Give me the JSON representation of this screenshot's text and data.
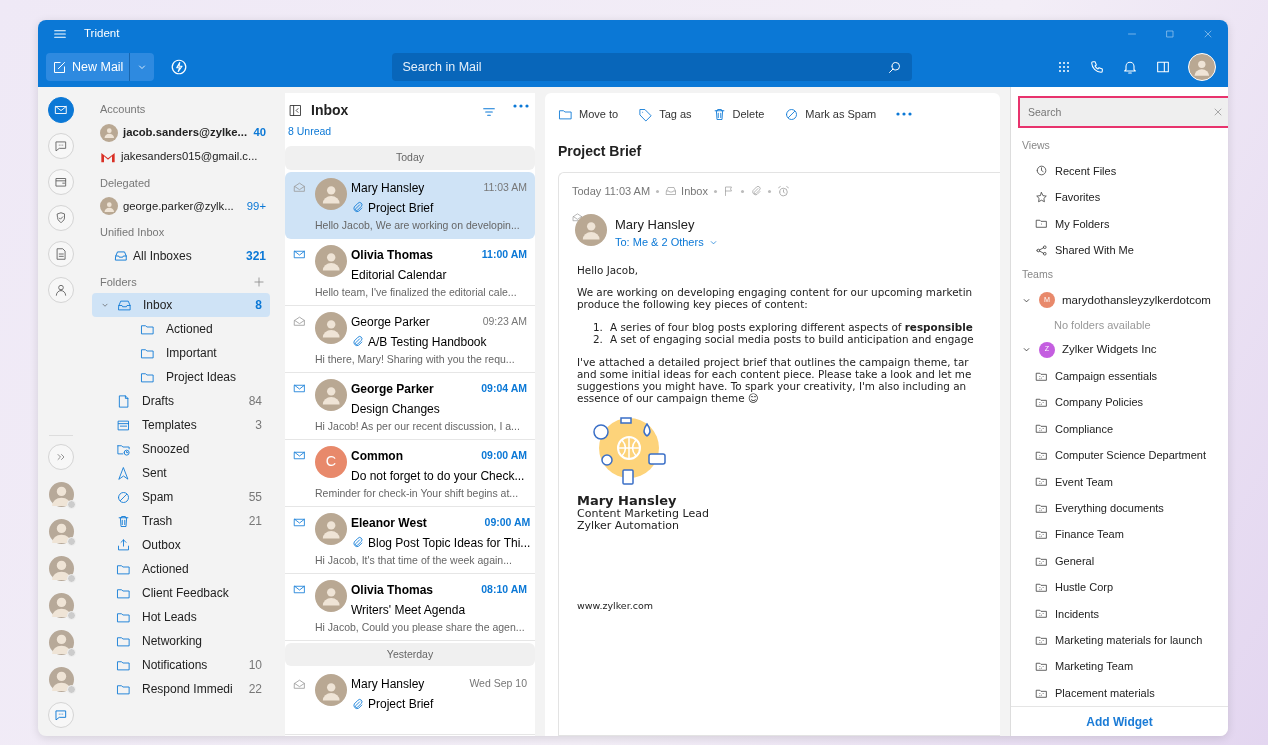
{
  "window": {
    "title": "Trident"
  },
  "toolbar": {
    "new_mail": "New Mail",
    "search": {
      "placeholder": "Search in Mail"
    }
  },
  "rail": {
    "apps": [
      {
        "selected": true
      },
      {
        "selected": false
      },
      {
        "selected": false
      },
      {
        "selected": false
      },
      {
        "selected": false
      },
      {
        "selected": false
      }
    ]
  },
  "accounts": {
    "title": "Accounts",
    "items": [
      {
        "kind": "photo",
        "label": "jacob.sanders@zylke...",
        "count": "40",
        "unread": true
      },
      {
        "kind": "gmail",
        "label": "jakesanders015@gmail.c...",
        "unread": false
      }
    ]
  },
  "delegated": {
    "title": "Delegated",
    "items": [
      {
        "kind": "photo",
        "label": "george.parker@zylk...",
        "count": "99+",
        "unread": false
      }
    ]
  },
  "unified": {
    "title": "Unified Inbox",
    "items": [
      {
        "kind": "inbox",
        "label": "All Inboxes",
        "count": "321",
        "unread": true
      }
    ]
  },
  "folders": {
    "title": "Folders",
    "items": [
      {
        "kind": "inbox",
        "label": "Inbox",
        "count": "8",
        "unread": true,
        "selected": true,
        "expanded": true,
        "children": [
          {
            "kind": "folder",
            "label": "Actioned",
            "selected": false
          },
          {
            "kind": "folder",
            "label": "Important",
            "selected": false
          },
          {
            "kind": "folder",
            "label": "Project Ideas",
            "selected": false
          }
        ]
      },
      {
        "kind": "drafts",
        "label": "Drafts",
        "count": "84",
        "unread": false,
        "selected": false
      },
      {
        "kind": "templates",
        "label": "Templates",
        "count": "3",
        "unread": false,
        "selected": false
      },
      {
        "kind": "snoozed",
        "label": "Snoozed",
        "selected": false
      },
      {
        "kind": "sent",
        "label": "Sent",
        "selected": false
      },
      {
        "kind": "spam",
        "label": "Spam",
        "count": "55",
        "unread": false,
        "selected": false
      },
      {
        "kind": "trash",
        "label": "Trash",
        "count": "21",
        "unread": false,
        "selected": false
      },
      {
        "kind": "outbox",
        "label": "Outbox",
        "selected": false
      },
      {
        "kind": "folder",
        "label": "Actioned",
        "selected": false
      },
      {
        "kind": "folder",
        "label": "Client Feedback",
        "selected": false
      },
      {
        "kind": "folder",
        "label": "Hot Leads",
        "selected": false
      },
      {
        "kind": "folder",
        "label": "Networking",
        "selected": false
      },
      {
        "kind": "folder",
        "label": "Notifications",
        "count": "10",
        "unread": false,
        "selected": false
      },
      {
        "kind": "folder",
        "label": "Respond Immedi",
        "count": "22",
        "unread": false,
        "selected": false
      }
    ]
  },
  "list": {
    "title": "Inbox",
    "unread_label": "8 Unread",
    "groups": [
      {
        "label": "Today",
        "messages": [
          {
            "sender": "Mary Hansley",
            "time": "11:03 AM",
            "subject": "Project Brief",
            "preview": "Hello Jacob, We are working on developin...",
            "unread": false,
            "attachment": true,
            "selected": true
          },
          {
            "sender": "Olivia Thomas",
            "time": "11:00 AM",
            "subject": "Editorial Calendar",
            "preview": "Hello team, I've finalized the editorial cale...",
            "unread": true,
            "attachment": false,
            "selected": false
          },
          {
            "sender": "George Parker",
            "time": "09:23 AM",
            "subject": "A/B Testing Handbook",
            "preview": "Hi there, Mary! Sharing with you the requ...",
            "unread": false,
            "attachment": true,
            "selected": false
          },
          {
            "sender": "George Parker",
            "time": "09:04 AM",
            "subject": "Design Changes",
            "preview": "Hi Jacob! As per our recent discussion, I a...",
            "unread": true,
            "attachment": false,
            "selected": false
          },
          {
            "sender": "Common",
            "initial": "C",
            "color": "#e8896b",
            "time": "09:00 AM",
            "subject": "Do not forget to do your Check...",
            "preview": "Reminder for check-in Your shift begins at...",
            "unread": true,
            "attachment": false,
            "selected": false
          },
          {
            "sender": "Eleanor West",
            "time": "09:00 AM",
            "subject": "Blog Post Topic Ideas for Thi...",
            "preview": "Hi Jacob, It's that time of the week again...",
            "unread": true,
            "attachment": true,
            "selected": false
          },
          {
            "sender": "Olivia Thomas",
            "time": "08:10 AM",
            "subject": "Writers' Meet Agenda",
            "preview": "Hi Jacob, Could you please share the agen...",
            "unread": true,
            "attachment": false,
            "selected": false
          }
        ]
      },
      {
        "label": "Yesterday",
        "messages": [
          {
            "sender": "Mary Hansley",
            "time": "Wed Sep 10",
            "subject": "Project Brief",
            "unread": false,
            "attachment": true,
            "selected": false
          }
        ]
      }
    ]
  },
  "reader": {
    "actions": [
      {
        "kind": "move",
        "label": "Move to"
      },
      {
        "kind": "tag",
        "label": "Tag as"
      },
      {
        "kind": "delete",
        "label": "Delete"
      },
      {
        "kind": "spam",
        "label": "Mark as Spam"
      },
      {
        "kind": "more"
      }
    ],
    "subject": "Project Brief",
    "time": "Today 11:03 AM",
    "folder": "Inbox",
    "sender": "Mary Hansley",
    "recipients": "To: Me & 2 Others",
    "body": [
      {
        "kind": "p",
        "lines": [
          "Hello Jacob,"
        ]
      },
      {
        "kind": "p",
        "lines": [
          "We are working on developing engaging content for our upcoming marketin",
          "produce the following key pieces of content:"
        ]
      },
      {
        "kind": "ol",
        "items": [
          {
            "number": "1.",
            "text": "A series of four blog posts exploring different aspects of **responsible**"
          },
          {
            "number": "2.",
            "text": "A set of engaging social media posts to build anticipation and engage"
          }
        ]
      },
      {
        "kind": "p",
        "lines": [
          "I've attached a detailed project brief that outlines the campaign theme, tar",
          "and some initial ideas for each content piece. Please take a look and let me",
          "suggestions you might have. To spark your creativity, I'm also including an",
          "essence of our campaign theme 😊"
        ]
      }
    ],
    "signature": {
      "name": "Mary Hansley",
      "title": "Content Marketing Lead",
      "company": "Zylker Automation",
      "url": "www.zylker.com"
    }
  },
  "widgets": {
    "search": {
      "placeholder": "Search",
      "focused": true
    },
    "views": {
      "title": "Views",
      "items": [
        {
          "kind": "recent",
          "label": "Recent Files"
        },
        {
          "kind": "star",
          "label": "Favorites"
        },
        {
          "kind": "myfolder",
          "label": "My Folders"
        },
        {
          "kind": "share",
          "label": "Shared With Me"
        }
      ]
    },
    "teams": {
      "title": "Teams",
      "items": [
        {
          "label": "marydothansleyzylkerdotcom",
          "initial": "M",
          "color": "#e8896b",
          "expanded": true,
          "empty_text": "No folders available"
        },
        {
          "label": "Zylker Widgets Inc",
          "initial": "Z",
          "color": "#c45ee0",
          "expanded": true,
          "children": [
            {
              "label": "Campaign essentials"
            },
            {
              "label": "Company Policies"
            },
            {
              "label": "Compliance"
            },
            {
              "label": "Computer Science Department"
            },
            {
              "label": "Event Team"
            },
            {
              "label": "Everything documents"
            },
            {
              "label": "Finance Team"
            },
            {
              "label": "General"
            },
            {
              "label": "Hustle Corp"
            },
            {
              "label": "Incidents"
            },
            {
              "label": "Marketing materials for launch"
            },
            {
              "label": "Marketing Team"
            },
            {
              "label": "Placement materials"
            }
          ]
        }
      ]
    },
    "footer": "Add Widget"
  }
}
